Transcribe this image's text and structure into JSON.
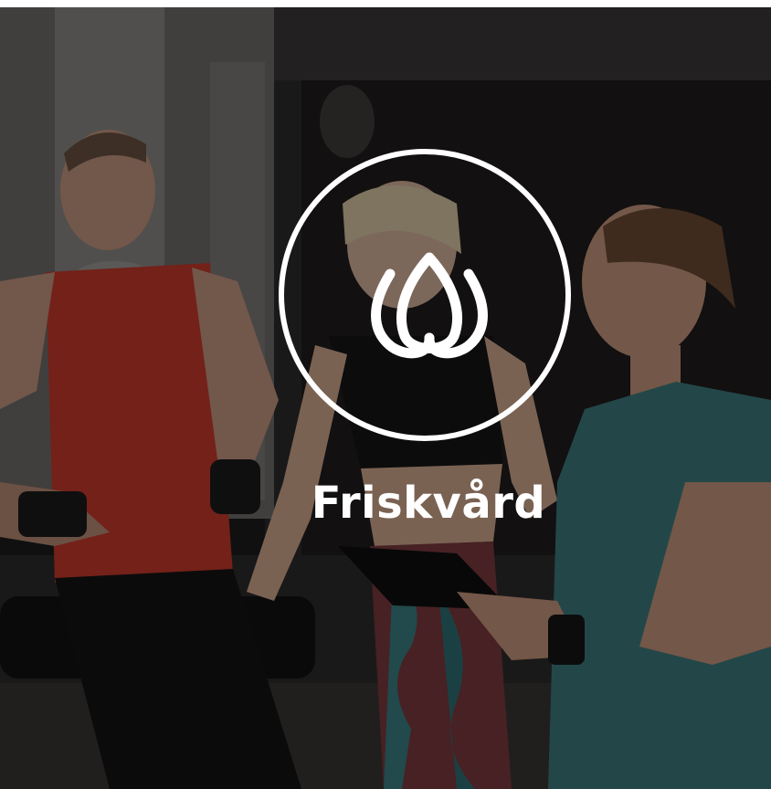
{
  "card": {
    "title": "Friskvård",
    "icon": "lotus-icon",
    "image": "gym-trainers-photo"
  },
  "colors": {
    "overlay": "#000000",
    "text": "#ffffff",
    "ring": "#ffffff"
  }
}
